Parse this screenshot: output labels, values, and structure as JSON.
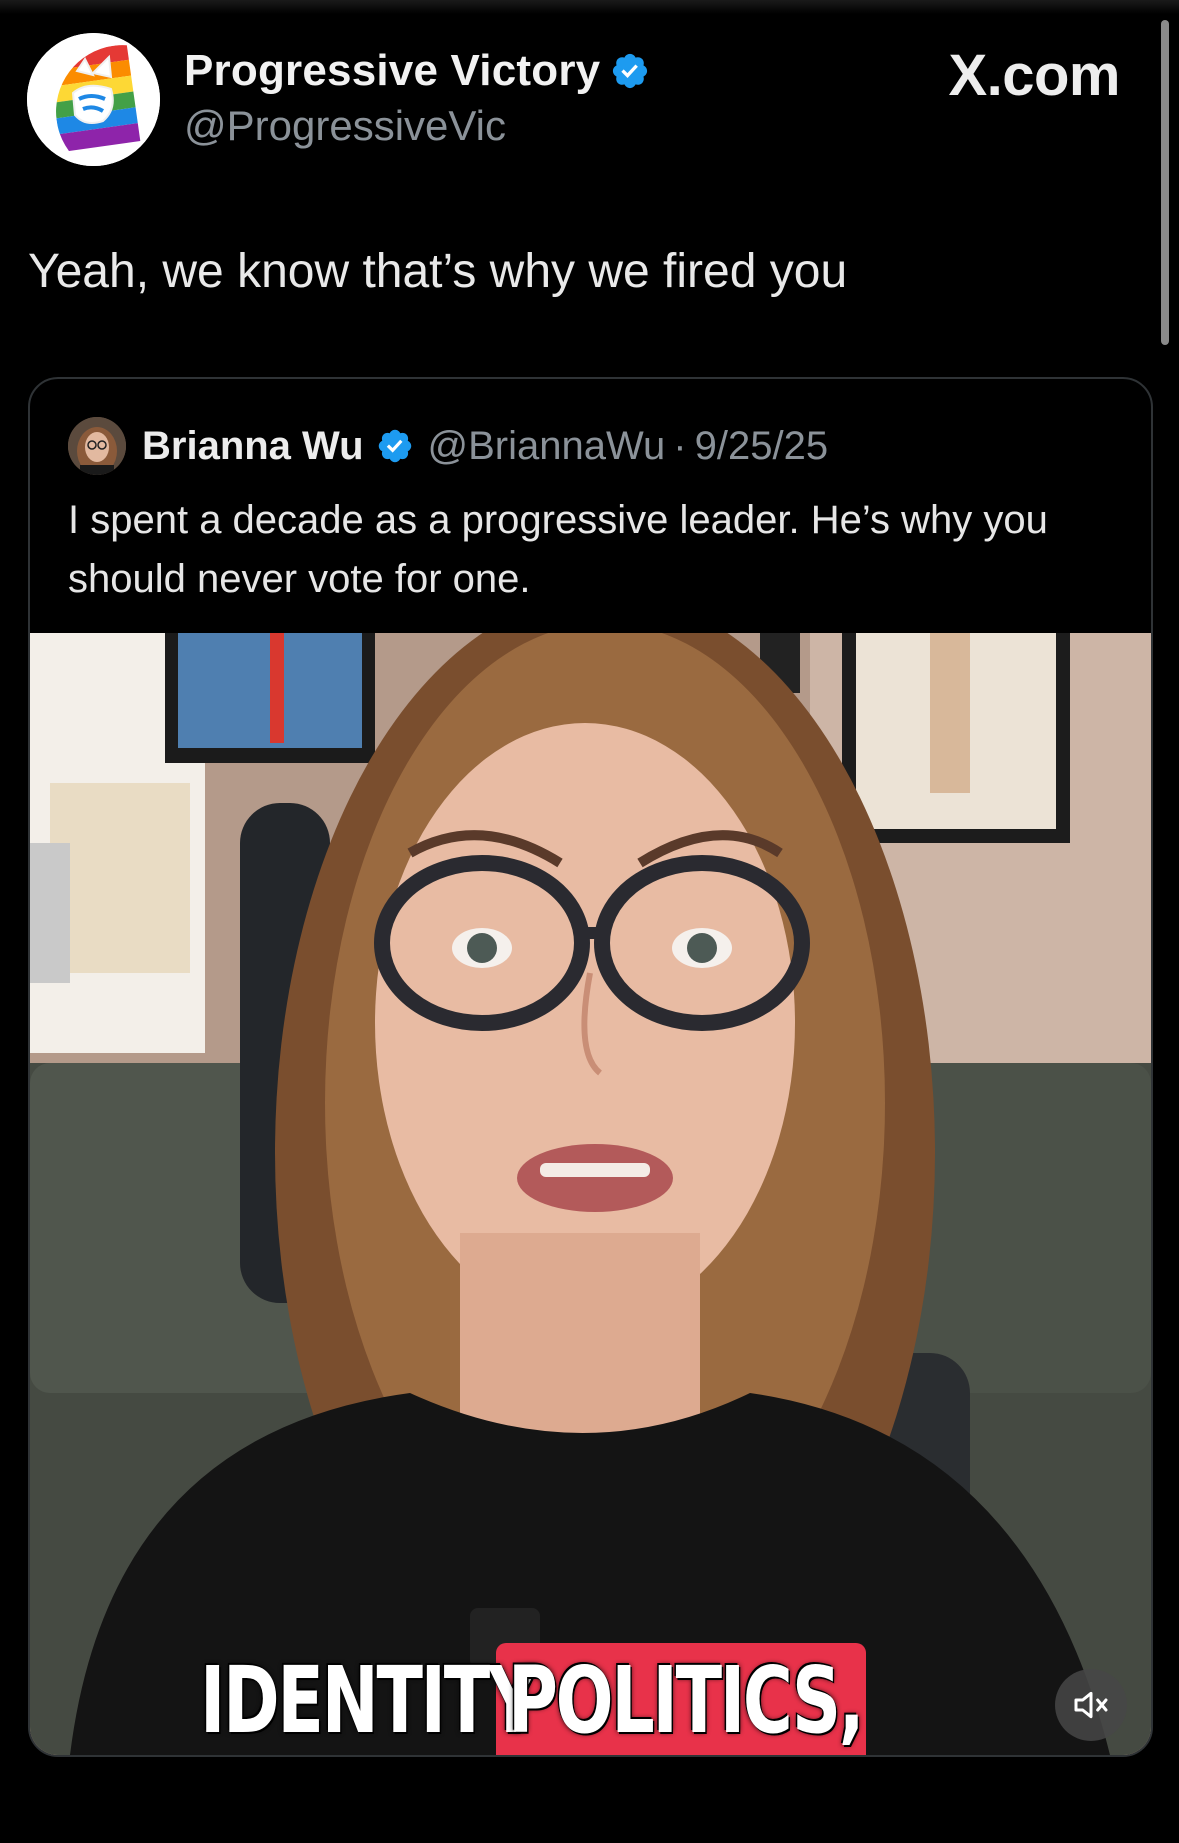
{
  "post": {
    "author_name": "Progressive Victory",
    "author_handle": "@ProgressiveVic",
    "site_label": "X.com",
    "text": "Yeah, we know that’s why we fired you"
  },
  "quoted_post": {
    "author_name": "Brianna Wu",
    "author_handle": "@BriannaWu",
    "separator": "·",
    "date": "9/25/25",
    "text": "I spent a decade as a progressive leader. He’s why you should never vote for one.",
    "video": {
      "caption_word_1": "IDENTITY",
      "caption_word_2": "POLITICS,",
      "mute_icon": "mute-icon"
    }
  },
  "colors": {
    "background": "#000000",
    "verified_badge": "#1d9bf0",
    "caption_highlight": "#e8324a"
  }
}
